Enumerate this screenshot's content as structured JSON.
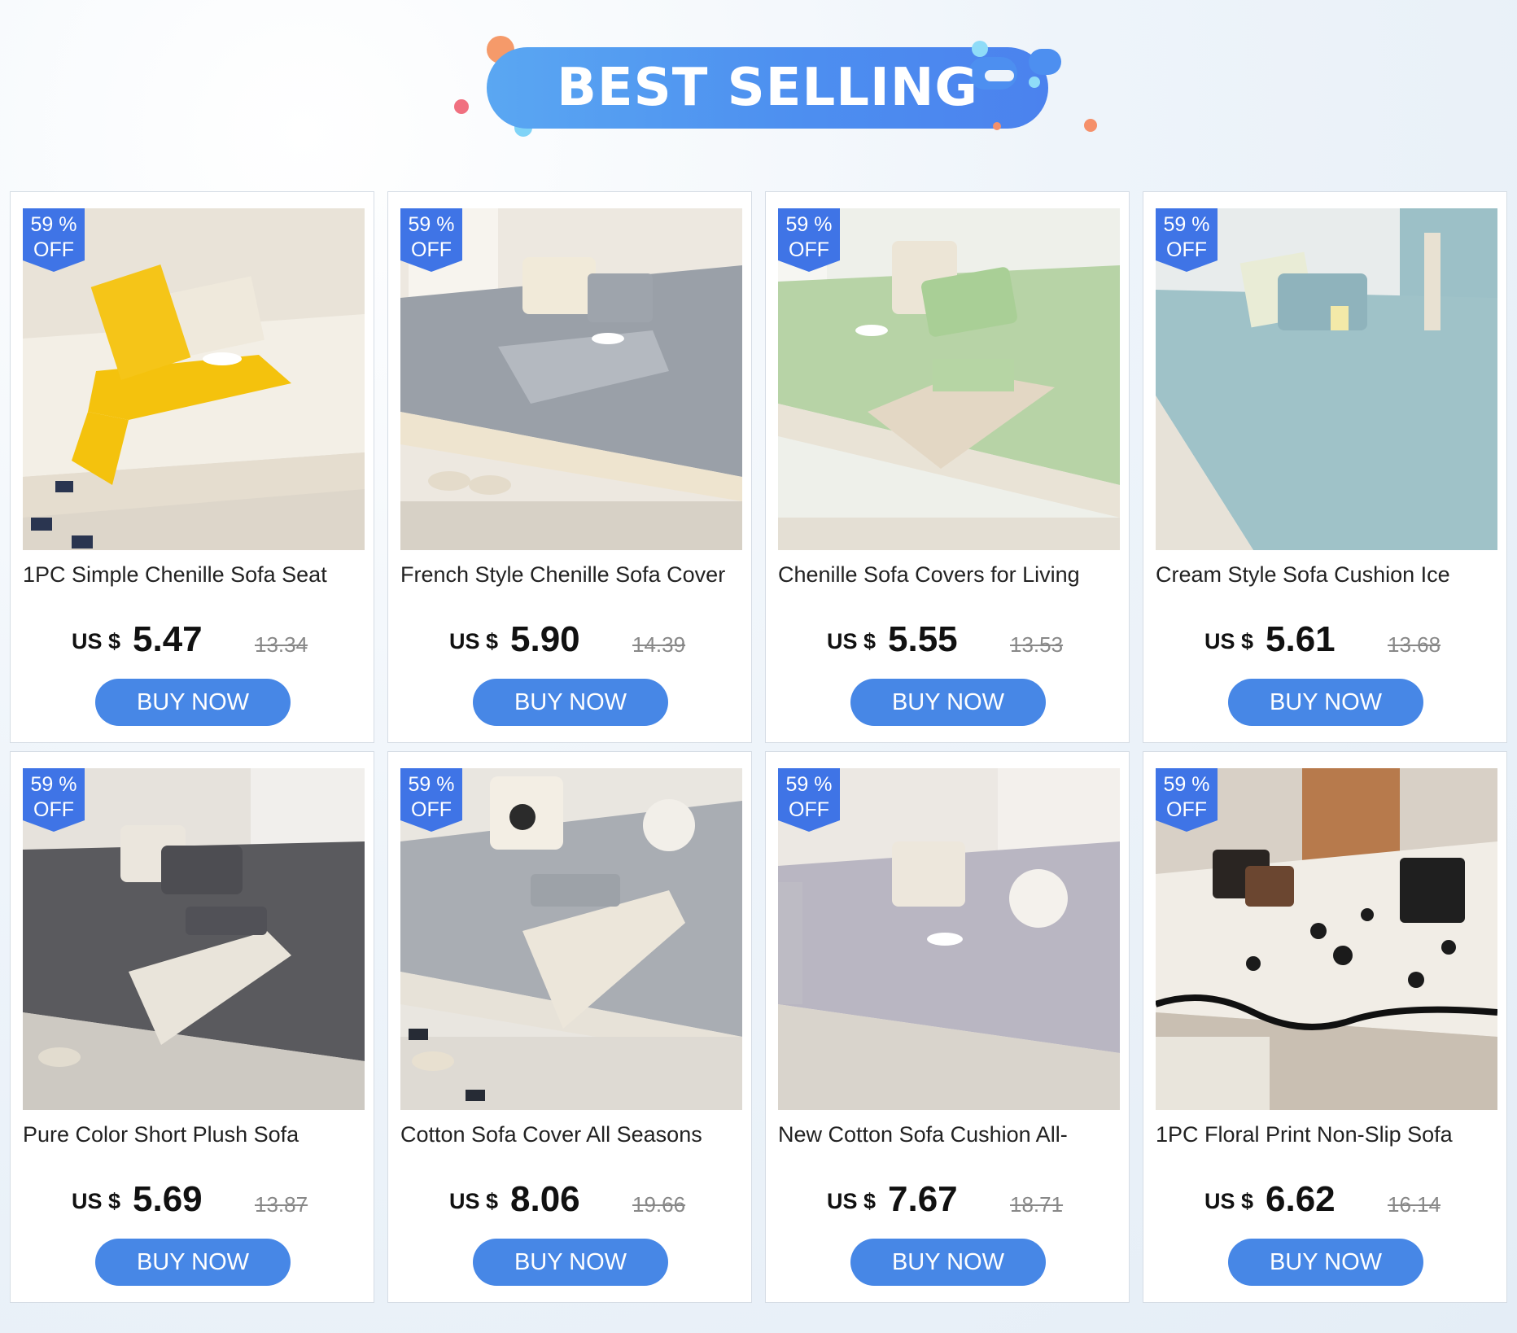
{
  "banner": {
    "title": "BEST SELLING"
  },
  "colors": {
    "accent": "#4787e6",
    "badge": "#3f74e6",
    "banner_blue": "#4d8ff0",
    "dot_orange": "#f58a5a",
    "dot_cyan": "#6fd0f5"
  },
  "products": [
    {
      "badge_line1": "59 %",
      "badge_line2": "OFF",
      "title": "1PC Simple Chenille Sofa Seat",
      "currency": "US $",
      "price": "5.47",
      "old_price": "13.34",
      "button": "BUY NOW",
      "theme": "cream-yellow"
    },
    {
      "badge_line1": "59 %",
      "badge_line2": "OFF",
      "title": "French Style Chenille Sofa Cover",
      "currency": "US $",
      "price": "5.90",
      "old_price": "14.39",
      "button": "BUY NOW",
      "theme": "grey-lace"
    },
    {
      "badge_line1": "59 %",
      "badge_line2": "OFF",
      "title": "Chenille Sofa Covers for Living",
      "currency": "US $",
      "price": "5.55",
      "old_price": "13.53",
      "button": "BUY NOW",
      "theme": "mint-green"
    },
    {
      "badge_line1": "59 %",
      "badge_line2": "OFF",
      "title": "Cream Style Sofa Cushion Ice",
      "currency": "US $",
      "price": "5.61",
      "old_price": "13.68",
      "button": "BUY NOW",
      "theme": "light-blue"
    },
    {
      "badge_line1": "59 %",
      "badge_line2": "OFF",
      "title": "Pure Color Short Plush Sofa",
      "currency": "US $",
      "price": "5.69",
      "old_price": "13.87",
      "button": "BUY NOW",
      "theme": "dark-grey"
    },
    {
      "badge_line1": "59 %",
      "badge_line2": "OFF",
      "title": "Cotton Sofa Cover All Seasons",
      "currency": "US $",
      "price": "8.06",
      "old_price": "19.66",
      "button": "BUY NOW",
      "theme": "grey-quilted"
    },
    {
      "badge_line1": "59 %",
      "badge_line2": "OFF",
      "title": "New Cotton Sofa Cushion All-",
      "currency": "US $",
      "price": "7.67",
      "old_price": "18.71",
      "button": "BUY NOW",
      "theme": "lilac-grey"
    },
    {
      "badge_line1": "59 %",
      "badge_line2": "OFF",
      "title": "1PC Floral Print Non-Slip Sofa",
      "currency": "US $",
      "price": "6.62",
      "old_price": "16.14",
      "button": "BUY NOW",
      "theme": "floral-bw"
    }
  ]
}
